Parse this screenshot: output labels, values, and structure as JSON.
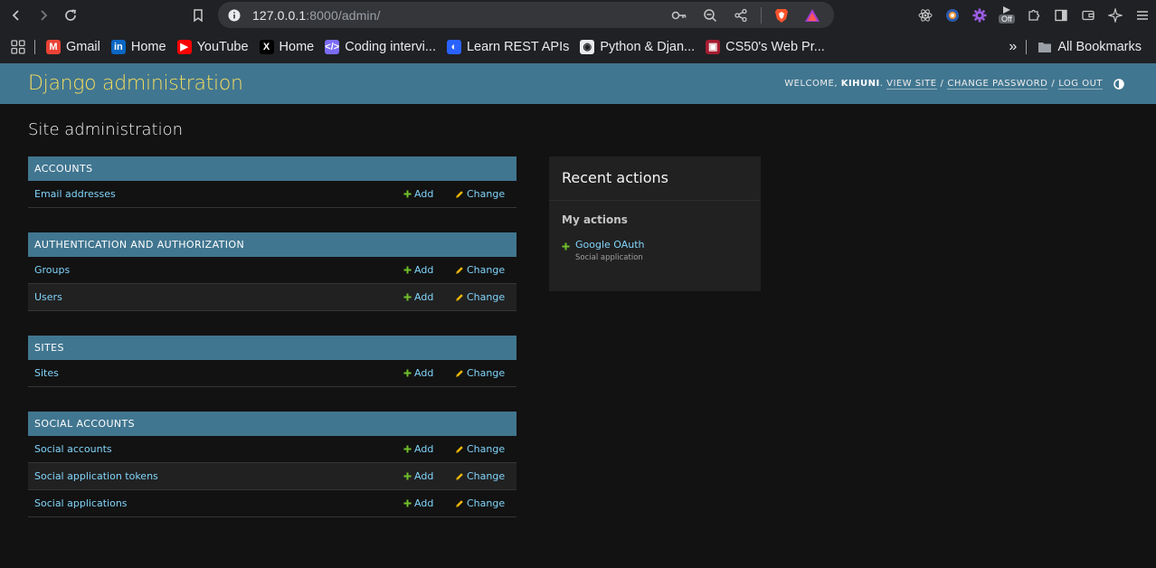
{
  "browser": {
    "url_host": "127.0.0.1",
    "url_rest": ":8000/admin/",
    "ext_badge": "Off"
  },
  "bookmarks": {
    "items": [
      {
        "label": "Gmail",
        "color": "#ea4335",
        "glyph": "M"
      },
      {
        "label": "Home",
        "color": "#0a66c2",
        "glyph": "in"
      },
      {
        "label": "YouTube",
        "color": "#ff0000",
        "glyph": "▶"
      },
      {
        "label": "Home",
        "color": "#000000",
        "glyph": "X"
      },
      {
        "label": "Coding intervi...",
        "color": "#7b6cf6",
        "glyph": "</>"
      },
      {
        "label": "Learn REST APIs",
        "color": "#2962ff",
        "glyph": "◐"
      },
      {
        "label": "Python & Djan...",
        "color": "#e8eaed",
        "glyph": "◉"
      },
      {
        "label": "CS50's Web Pr...",
        "color": "#a51c30",
        "glyph": "▣"
      }
    ],
    "all_bookmarks": "All Bookmarks"
  },
  "header": {
    "branding": "Django administration",
    "welcome": "WELCOME,",
    "username": "KIHUNI",
    "view_site": "VIEW SITE",
    "change_password": "CHANGE PASSWORD",
    "log_out": "LOG OUT"
  },
  "main": {
    "title": "Site administration",
    "add_label": "Add",
    "change_label": "Change",
    "modules": [
      {
        "caption": "Accounts",
        "models": [
          "Email addresses"
        ]
      },
      {
        "caption": "Authentication and Authorization",
        "models": [
          "Groups",
          "Users"
        ]
      },
      {
        "caption": "Sites",
        "models": [
          "Sites"
        ]
      },
      {
        "caption": "Social Accounts",
        "models": [
          "Social accounts",
          "Social application tokens",
          "Social applications"
        ]
      }
    ]
  },
  "recent": {
    "title": "Recent actions",
    "subtitle": "My actions",
    "entries": [
      {
        "label": "Google OAuth",
        "type": "Social application",
        "action": "add"
      }
    ]
  },
  "colors": {
    "header_bg": "#417690",
    "branding": "#f5dd5d",
    "link": "#81d4fa",
    "add_icon": "#70bf2b",
    "change_icon": "#efb80b"
  }
}
